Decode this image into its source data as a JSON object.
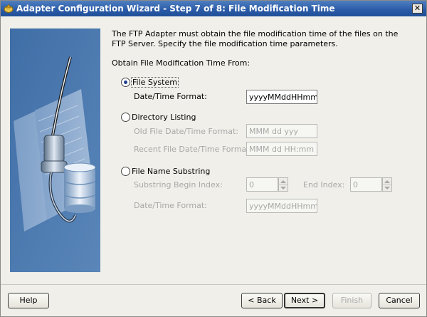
{
  "window": {
    "title": "Adapter Configuration Wizard - Step 7 of 8: File Modification Time",
    "close_glyph": "✕"
  },
  "intro_text": "The FTP Adapter must obtain the file modification time of the files on the FTP Server. Specify the file modification time parameters.",
  "section_label": "Obtain File Modification Time From:",
  "options": {
    "file_system": {
      "label": "File System",
      "selected": true,
      "datetime_label": "Date/Time Format:",
      "datetime_value": "yyyyMMddHHmmSS"
    },
    "directory_listing": {
      "label": "Directory Listing",
      "selected": false,
      "old_label": "Old File Date/Time Format:",
      "old_placeholder": "MMM dd yyy",
      "recent_label": "Recent File Date/Time Format:",
      "recent_placeholder": "MMM dd HH:mm"
    },
    "file_name_substring": {
      "label": "File Name Substring",
      "selected": false,
      "begin_label": "Substring Begin Index:",
      "begin_value": "0",
      "end_label": "End Index:",
      "end_value": "0",
      "datetime_label": "Date/Time Format:",
      "datetime_placeholder": "yyyyMMddHHmmSS"
    }
  },
  "buttons": {
    "help": "Help",
    "back": "< Back",
    "next": "Next >",
    "finish": "Finish",
    "cancel": "Cancel"
  }
}
